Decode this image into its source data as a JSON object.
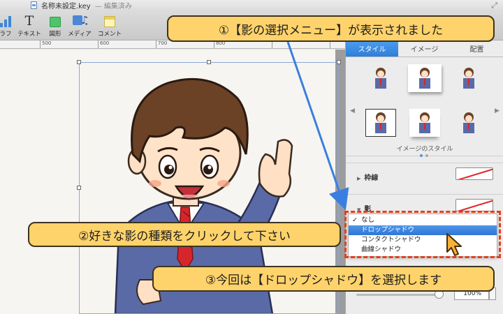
{
  "window": {
    "title": "名称未設定.key",
    "state": "— 編集済み"
  },
  "toolbar": {
    "items": [
      {
        "id": "graph",
        "label": "ラフ",
        "icon": "bar-chart-icon"
      },
      {
        "id": "text",
        "label": "テキスト",
        "icon": "text-icon"
      },
      {
        "id": "shape",
        "label": "図形",
        "icon": "shape-icon"
      },
      {
        "id": "media",
        "label": "メディア",
        "icon": "media-music-icon"
      },
      {
        "id": "comment",
        "label": "コメント",
        "icon": "comment-icon"
      }
    ]
  },
  "ruler": {
    "marks": [
      "500",
      "600",
      "700",
      "800"
    ]
  },
  "inspector": {
    "tabs": [
      {
        "label": "スタイル",
        "active": true
      },
      {
        "label": "イメージ",
        "active": false
      },
      {
        "label": "配置",
        "active": false
      }
    ],
    "image_styles_label": "イメージのスタイル",
    "border_label": "枠線",
    "shadow_label": "影",
    "shadow_menu": {
      "options": [
        "なし",
        "ドロップシャドウ",
        "コンタクトシャドウ",
        "曲線シャドウ"
      ],
      "checked": "なし",
      "highlighted": "ドロップシャドウ"
    },
    "opacity_value": "100%"
  },
  "callouts": {
    "step1": "①【影の選択メニュー】が表示されました",
    "step2": "②好きな影の種類をクリックして下さい",
    "step3": "③今回は【ドロップシャドウ】を選択します"
  },
  "colors": {
    "callout_bg": "#ffd36b",
    "accent_blue": "#2f7fd8",
    "highlight_dash": "#e2401c",
    "arrow": "#3a7fe0"
  }
}
